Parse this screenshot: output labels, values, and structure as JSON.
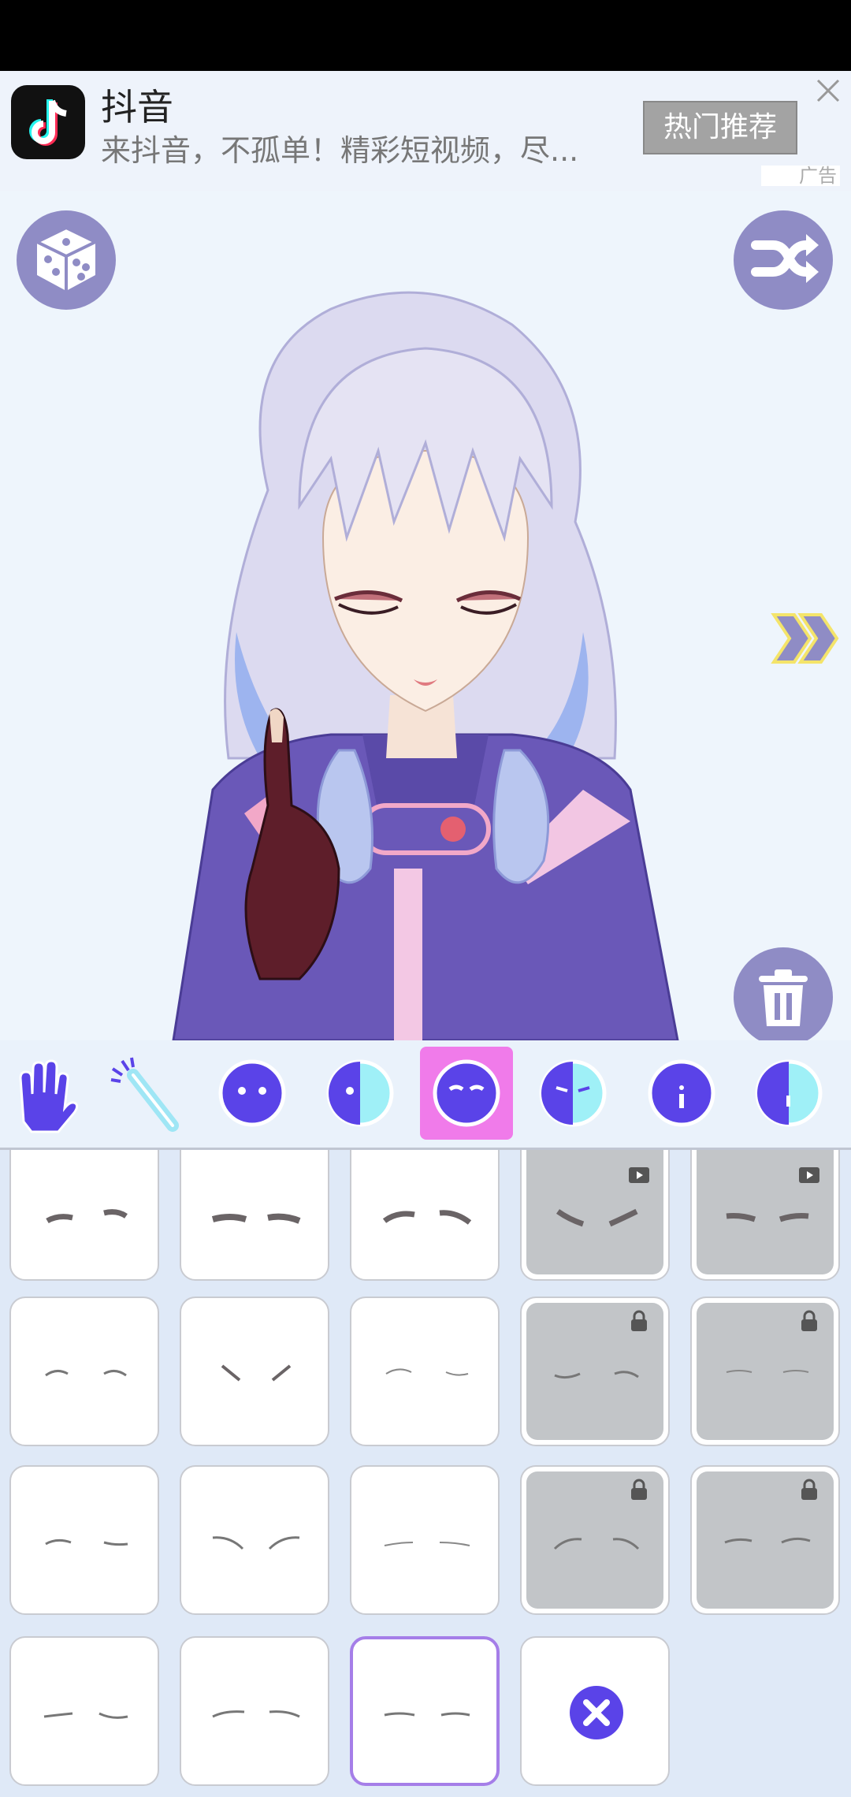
{
  "ad": {
    "app_name": "抖音",
    "description": "来抖音，不孤单！精彩短视频，尽...",
    "button_label": "热门推荐",
    "ad_tag": "广告"
  },
  "stage": {
    "buttons": [
      "dice-icon",
      "shuffle-icon",
      "next-arrows-icon",
      "trash-icon"
    ]
  },
  "toolbar": {
    "tools": [
      "hand-icon",
      "wand-icon",
      "face-icon",
      "half-face-icon",
      "eyes-icon",
      "eye-detail-icon",
      "mouth-icon",
      "half-face-detail-icon"
    ],
    "selected_index": 4
  },
  "grid": {
    "rows": [
      [
        "brow-style-1",
        "brow-style-2",
        "brow-style-3",
        "brow-style-4-video-locked",
        "brow-style-5-video-locked"
      ],
      [
        "brow-style-6",
        "brow-style-7",
        "brow-style-8",
        "brow-style-9-locked",
        "brow-style-10-locked"
      ],
      [
        "brow-style-11",
        "brow-style-12",
        "brow-style-13",
        "brow-style-14-locked",
        "brow-style-15-locked"
      ],
      [
        "brow-style-16",
        "brow-style-17",
        "brow-style-18-selected",
        "none-option"
      ]
    ]
  },
  "colors": {
    "accent": "#5a43e8",
    "selected_tool": "#f07bea",
    "stage_button": "#8f8cc5",
    "selected_cell_border": "#a57ee8"
  }
}
